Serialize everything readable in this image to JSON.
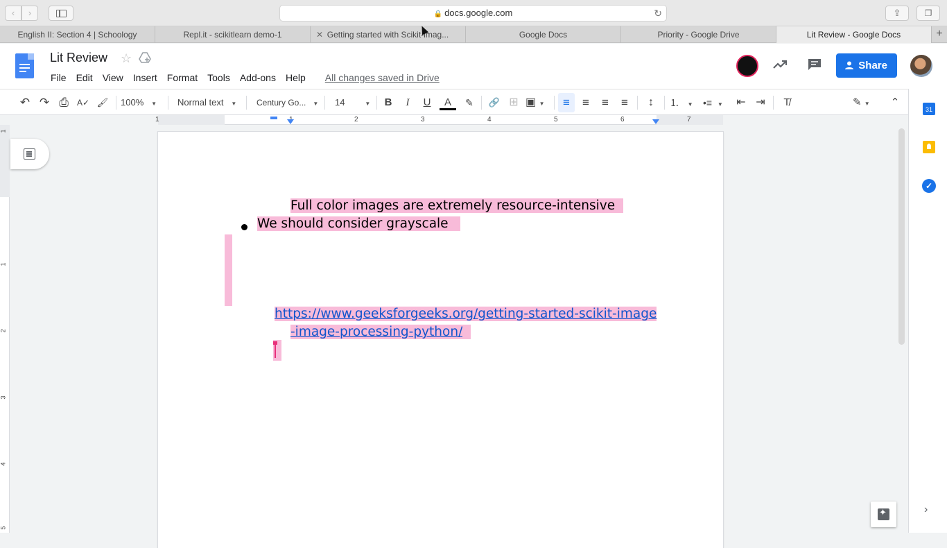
{
  "browser": {
    "url": "docs.google.com",
    "back_glyph": "‹",
    "forward_glyph": "›",
    "share_glyph": "⇪",
    "tabs_glyph": "❐",
    "reload_glyph": "↻",
    "lock_glyph": "🔒",
    "tabs": [
      {
        "label": "English II: Section 4 | Schoology",
        "active": false
      },
      {
        "label": "Repl.it - scikitlearn demo-1",
        "active": false
      },
      {
        "label": "Getting started with Scikit-imag...",
        "active": false,
        "closable": true
      },
      {
        "label": "Google Docs",
        "active": false
      },
      {
        "label": "Priority - Google Drive",
        "active": false
      },
      {
        "label": "Lit Review - Google Docs",
        "active": true
      }
    ],
    "new_tab_glyph": "+"
  },
  "docs": {
    "title": "Lit Review",
    "star_glyph": "☆",
    "menu": [
      "File",
      "Edit",
      "View",
      "Insert",
      "Format",
      "Tools",
      "Add-ons",
      "Help"
    ],
    "saved_status": "All changes saved in Drive",
    "share_label": "Share"
  },
  "toolbar": {
    "undo_glyph": "↶",
    "redo_glyph": "↷",
    "print_glyph": "⎙",
    "spell_glyph": "A✓",
    "paint_glyph": "🖌",
    "zoom": "100%",
    "style": "Normal text",
    "font": "Century Go...",
    "font_size": "14",
    "bold": "B",
    "italic": "I",
    "underline": "U",
    "text_color": "A",
    "highlight_glyph": "✎",
    "link_glyph": "🔗",
    "comment_glyph": "⊞",
    "image_glyph": "▣",
    "align_left_glyph": "≡",
    "align_center_glyph": "≡",
    "align_right_glyph": "≡",
    "justify_glyph": "≡",
    "line_spacing_glyph": "↕",
    "numbered_list_glyph": "⒈",
    "bulleted_list_glyph": "•≡",
    "decrease_indent_glyph": "⇤",
    "increase_indent_glyph": "⇥",
    "clear_format_glyph": "T̸",
    "editing_glyph": "✎",
    "collapse_glyph": "⌃",
    "dropdown_glyph": "▼"
  },
  "ruler": {
    "h_numbers": [
      "1",
      "1",
      "2",
      "3",
      "4",
      "5",
      "6",
      "7"
    ],
    "v_numbers": [
      "1",
      "1",
      "2",
      "3",
      "4",
      "5"
    ]
  },
  "document": {
    "line1": "Full color images are extremely resource-intensive",
    "bullet1": "We should consider grayscale",
    "link_line1": "https://www.geeksforgeeks.org/getting-started-scikit-image",
    "link_line2": "-image-processing-python/"
  },
  "side_panel": {
    "calendar_label": "31",
    "tasks_glyph": "✓",
    "expand_glyph": "›"
  },
  "colors": {
    "highlight": "#f8bbd9",
    "link": "#1155cc",
    "share_button": "#1a73e8",
    "cursor": "#e8307a"
  }
}
